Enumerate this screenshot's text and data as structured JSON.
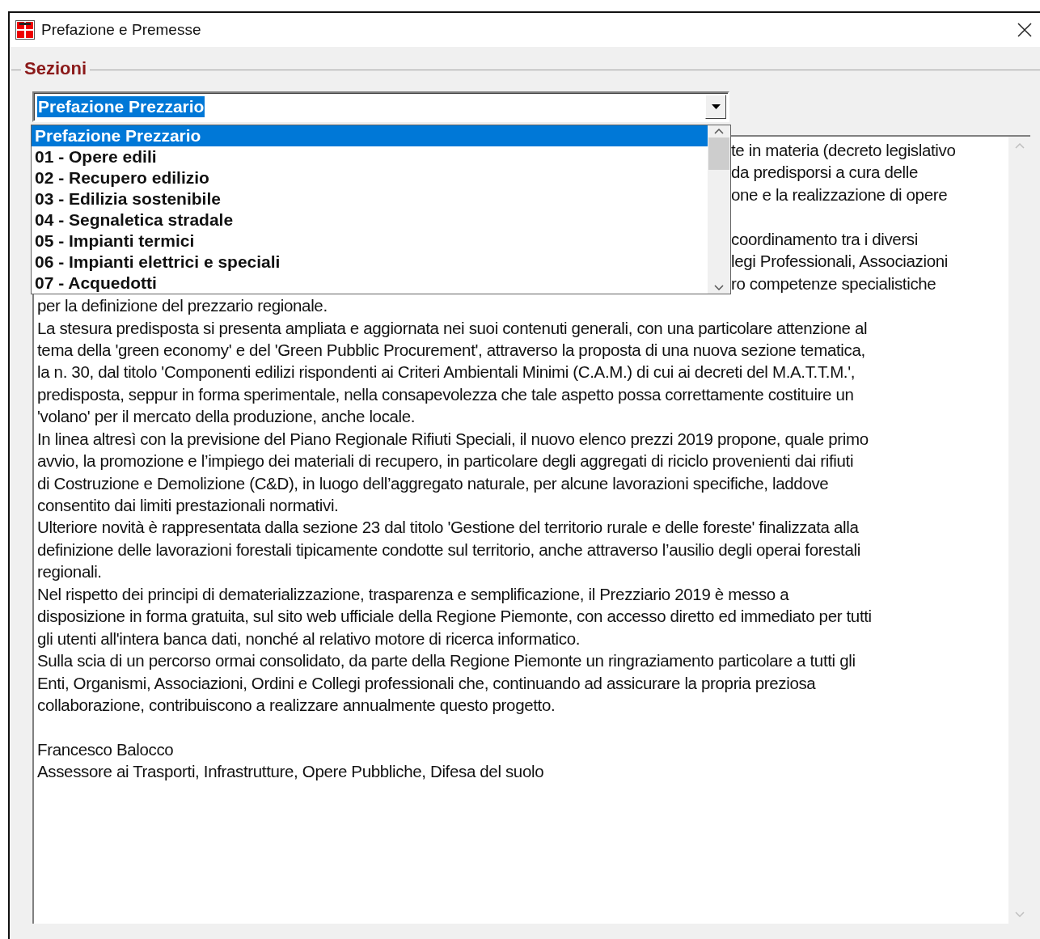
{
  "window": {
    "title": "Prefazione e Premesse"
  },
  "group": {
    "label": "Sezioni"
  },
  "combo": {
    "value": "Prefazione Prezzario",
    "expanded": true
  },
  "options": [
    {
      "label": "Prefazione Prezzario",
      "selected": true
    },
    {
      "label": "01 - Opere edili",
      "selected": false
    },
    {
      "label": "02 - Recupero edilizio",
      "selected": false
    },
    {
      "label": "03 - Edilizia sostenibile",
      "selected": false
    },
    {
      "label": "04 - Segnaletica stradale",
      "selected": false
    },
    {
      "label": "05 - Impianti termici",
      "selected": false
    },
    {
      "label": "06 - Impianti elettrici e speciali",
      "selected": false
    },
    {
      "label": "07 - Acquedotti",
      "selected": false
    }
  ],
  "text_lines": [
    {
      "kind": "fragment",
      "text": "te in materia (decreto legislativo"
    },
    {
      "kind": "fragment",
      "text": "da predisporsi a cura delle"
    },
    {
      "kind": "fragment",
      "text": "one e la realizzazione di opere"
    },
    {
      "kind": "blank"
    },
    {
      "kind": "fragment",
      "text": "coordinamento tra i diversi"
    },
    {
      "kind": "fragment",
      "text": "legi Professionali, Associazioni"
    },
    {
      "kind": "fragment",
      "text": "ro competenze specialistiche"
    },
    {
      "kind": "line",
      "text": "per la definizione del prezzario regionale."
    },
    {
      "kind": "line",
      "text": "La stesura predisposta si presenta ampliata e aggiornata nei suoi contenuti generali, con una particolare attenzione al"
    },
    {
      "kind": "line",
      "text": "tema della 'green economy' e del 'Green Pubblic Procurement', attraverso la proposta di una nuova sezione tematica,"
    },
    {
      "kind": "line",
      "text": "la n. 30, dal titolo 'Componenti edilizi rispondenti ai Criteri Ambientali Minimi (C.A.M.) di cui ai decreti del M.A.T.T.M.',"
    },
    {
      "kind": "line",
      "text": "predisposta, seppur in forma sperimentale, nella consapevolezza che tale aspetto possa correttamente costituire un"
    },
    {
      "kind": "line",
      "text": "'volano' per il mercato della produzione, anche locale."
    },
    {
      "kind": "line",
      "text": "In linea altresì con la previsione del Piano Regionale Rifiuti Speciali, il nuovo elenco prezzi 2019 propone, quale primo"
    },
    {
      "kind": "line",
      "text": "avvio, la promozione e l’impiego dei materiali di recupero, in particolare degli aggregati  di riciclo provenienti dai rifiuti"
    },
    {
      "kind": "line",
      "text": "di Costruzione e Demolizione (C&D), in luogo dell’aggregato naturale, per alcune lavorazioni specifiche, laddove"
    },
    {
      "kind": "line",
      "text": "consentito dai limiti prestazionali normativi."
    },
    {
      "kind": "line",
      "text": "Ulteriore novità è rappresentata dalla sezione 23 dal titolo 'Gestione del territorio rurale e delle foreste' finalizzata alla"
    },
    {
      "kind": "line",
      "text": "definizione delle lavorazioni forestali tipicamente condotte sul territorio, anche attraverso l’ausilio degli operai forestali"
    },
    {
      "kind": "line",
      "text": "regionali."
    },
    {
      "kind": "line",
      "text": "Nel rispetto dei principi di dematerializzazione, trasparenza e semplificazione, il Prezziario 2019 è messo a"
    },
    {
      "kind": "line",
      "text": "disposizione in forma gratuita, sul sito web ufficiale della Regione Piemonte, con accesso diretto ed immediato per tutti"
    },
    {
      "kind": "line",
      "text": "gli utenti all'intera banca dati, nonché al relativo motore di ricerca informatico."
    },
    {
      "kind": "line",
      "text": "Sulla scia di un percorso ormai consolidato, da parte della Regione Piemonte un ringraziamento particolare a tutti gli"
    },
    {
      "kind": "line",
      "text": "Enti, Organismi, Associazioni, Ordini e Collegi professionali che, continuando ad assicurare la propria preziosa"
    },
    {
      "kind": "line",
      "text": "collaborazione, contribuiscono a realizzare annualmente questo progetto."
    },
    {
      "kind": "blank"
    },
    {
      "kind": "line",
      "text": "Francesco Balocco"
    },
    {
      "kind": "line",
      "text": "Assessore ai Trasporti, Infrastrutture, Opere Pubbliche, Difesa del suolo"
    }
  ]
}
